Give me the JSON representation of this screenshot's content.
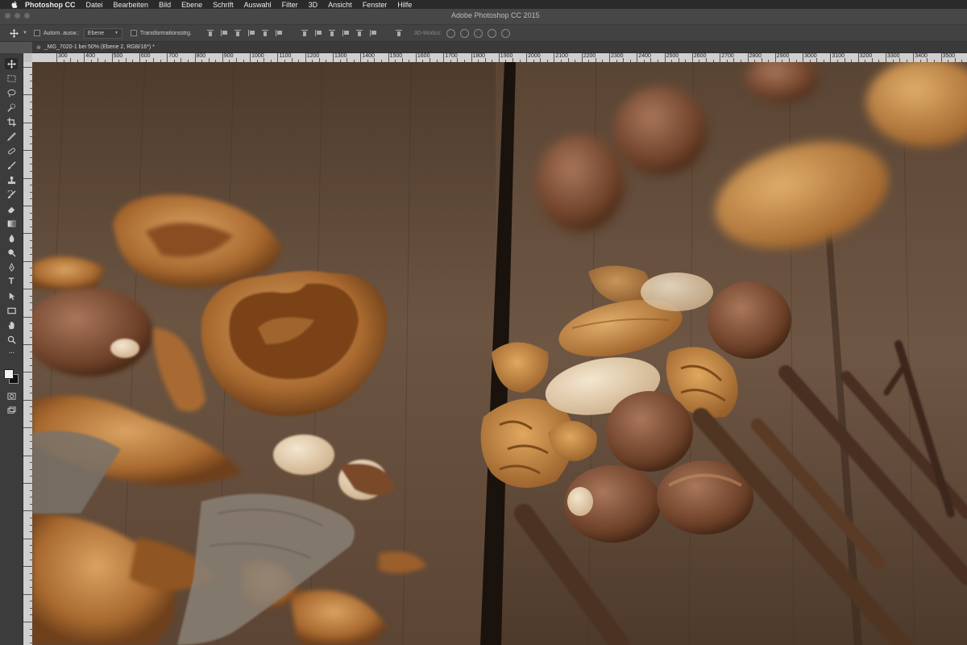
{
  "menubar": {
    "app_name": "Photoshop CC",
    "items": [
      "Datei",
      "Bearbeiten",
      "Bild",
      "Ebene",
      "Schrift",
      "Auswahl",
      "Filter",
      "3D",
      "Ansicht",
      "Fenster",
      "Hilfe"
    ]
  },
  "window": {
    "title": "Adobe Photoshop CC 2015"
  },
  "options_bar": {
    "auto_select_label": "Autom. ausw.:",
    "auto_select_value": "Ebene",
    "transform_label": "Transformationsstrg.",
    "mode_3d_label": "3D-Modus:"
  },
  "document": {
    "tab_title": "_MG_7020-1 bei 50% (Ebene 2, RGB/16*) *"
  },
  "ruler": {
    "labels": [
      "300",
      "400",
      "500",
      "600",
      "700",
      "800",
      "900",
      "1000",
      "1100",
      "1200",
      "1300",
      "1400",
      "1500",
      "1600",
      "1700",
      "1800",
      "1900",
      "2000",
      "2100",
      "2200",
      "2300",
      "2400",
      "2500",
      "2600",
      "2700",
      "2800",
      "2900",
      "3000",
      "3100",
      "3200",
      "3300",
      "3400",
      "3500",
      "3600"
    ]
  },
  "colors": {
    "menubar_bg": "#2a2a2a",
    "panel_bg": "#3c3c3c",
    "ruler_bg": "#cfcfcf",
    "foreground_color": "#f2f2f2",
    "background_color": "#111111"
  },
  "tools": [
    "move-tool",
    "marquee-tool",
    "lasso-tool",
    "quick-select-tool",
    "crop-tool",
    "eyedropper-tool",
    "healing-brush-tool",
    "brush-tool",
    "clone-stamp-tool",
    "history-brush-tool",
    "eraser-tool",
    "gradient-tool",
    "blur-tool",
    "dodge-tool",
    "pen-tool",
    "type-tool",
    "path-selection-tool",
    "rectangle-tool",
    "hand-tool",
    "zoom-tool",
    "more-tools"
  ]
}
